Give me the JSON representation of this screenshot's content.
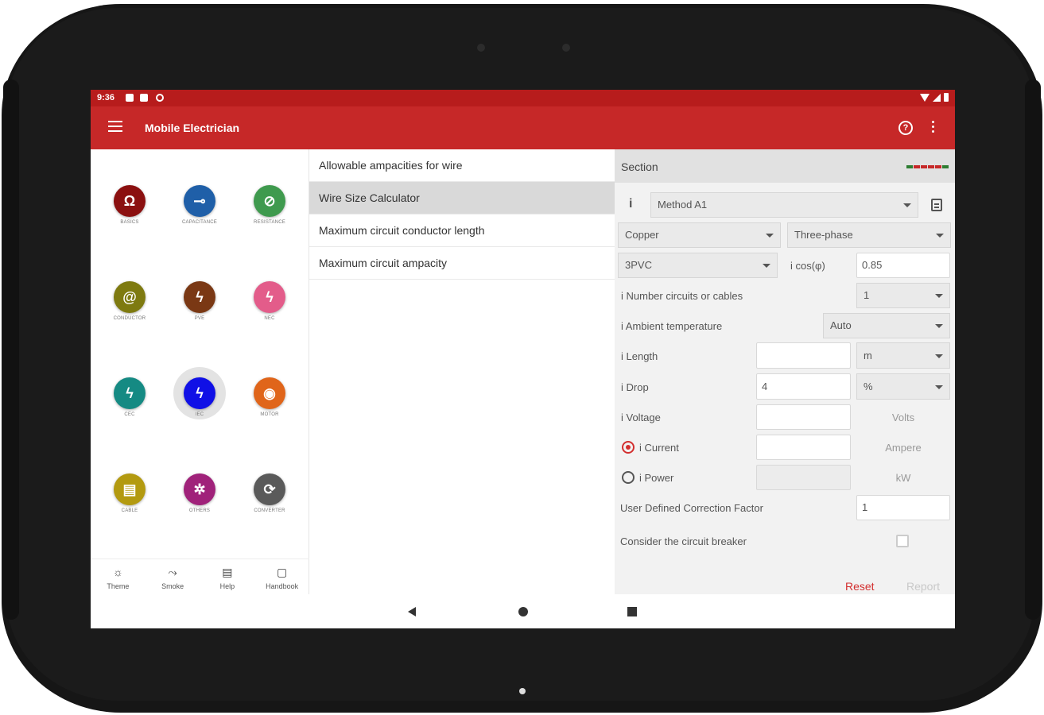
{
  "status": {
    "time": "9:36"
  },
  "appbar": {
    "title": "Mobile Electrician"
  },
  "categories": [
    {
      "label": "BASICS",
      "glyph": "Ω",
      "color": "#8b1010"
    },
    {
      "label": "CAPACITANCE",
      "glyph": "⊸",
      "color": "#1f5fa8"
    },
    {
      "label": "RESISTANCE",
      "glyph": "⊘",
      "color": "#3f9a4e"
    },
    {
      "label": "CONDUCTOR",
      "glyph": "@",
      "color": "#7e7a10"
    },
    {
      "label": "PVE",
      "glyph": "ϟ",
      "color": "#7a3814"
    },
    {
      "label": "NEC",
      "glyph": "ϟ",
      "color": "#e35c8a"
    },
    {
      "label": "CEC",
      "glyph": "ϟ",
      "color": "#158a83"
    },
    {
      "label": "IEC",
      "glyph": "ϟ",
      "color": "#1010e6"
    },
    {
      "label": "MOTOR",
      "glyph": "◉",
      "color": "#e0651a"
    },
    {
      "label": "CABLE",
      "glyph": "▤",
      "color": "#b39a10"
    },
    {
      "label": "OTHERS",
      "glyph": "✲",
      "color": "#a0227a"
    },
    {
      "label": "CONVERTER",
      "glyph": "⟳",
      "color": "#5a5a5a"
    }
  ],
  "bottom_nav": [
    {
      "label": "Theme",
      "glyph": "☼"
    },
    {
      "label": "Smoke",
      "glyph": "⤳"
    },
    {
      "label": "Help",
      "glyph": "▤"
    },
    {
      "label": "Handbook",
      "glyph": "▢"
    }
  ],
  "menu_list": [
    {
      "label": "Allowable ampacities for wire"
    },
    {
      "label": "Wire Size Calculator"
    },
    {
      "label": "Maximum circuit conductor length"
    },
    {
      "label": "Maximum circuit ampacity"
    }
  ],
  "form": {
    "section_title": "Section",
    "method": "Method A1",
    "material": "Copper",
    "phase": "Three-phase",
    "insulation": "3PVC",
    "cos_label": "i cos(φ)",
    "cos_value": "0.85",
    "circuits_label": "i Number circuits or cables",
    "circuits_value": "1",
    "ambient_label": "i Ambient temperature",
    "ambient_value": "Auto",
    "length_label": "i Length",
    "length_value": "",
    "length_unit": "m",
    "drop_label": "i Drop",
    "drop_value": "4",
    "drop_unit": "%",
    "voltage_label": "i Voltage",
    "voltage_value": "",
    "voltage_unit": "Volts",
    "current_label": "i Current",
    "current_value": "",
    "current_unit": "Ampere",
    "power_label": "i Power",
    "power_value": "",
    "power_unit": "kW",
    "correction_label": "User Defined Correction Factor",
    "correction_value": "1",
    "breaker_label": "Consider the circuit breaker",
    "reset_label": "Reset",
    "report_label": "Report",
    "info_glyph": "i"
  },
  "colors": {
    "primary": "#c62828",
    "primary_dark": "#b71c1c",
    "accent": "#d32f2f",
    "leds": [
      "#2e7d32",
      "#c62828",
      "#c62828",
      "#c62828",
      "#c62828",
      "#2e7d32"
    ]
  }
}
